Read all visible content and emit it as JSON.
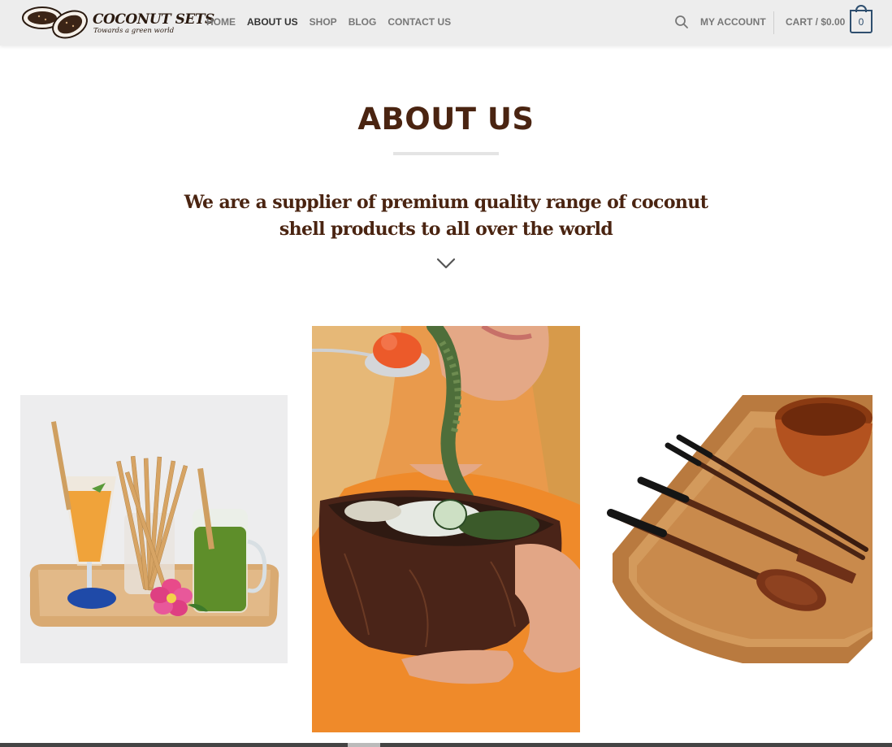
{
  "brand": {
    "name": "COCONUT SETS",
    "tagline": "Towards a green world"
  },
  "nav": {
    "items": [
      {
        "label": "HOME",
        "active": false
      },
      {
        "label": "ABOUT US",
        "active": true
      },
      {
        "label": "SHOP",
        "active": false
      },
      {
        "label": "BLOG",
        "active": false
      },
      {
        "label": "CONTACT US",
        "active": false
      }
    ],
    "account_label": "MY ACCOUNT",
    "cart_label": "CART / $0.00",
    "cart_count": "0"
  },
  "hero": {
    "title": "ABOUT US",
    "subtitle": "We are a supplier of premium quality range of coconut shell products to all over the world"
  },
  "gallery": {
    "images": [
      "bamboo-straws-photo",
      "coconut-bowl-photo",
      "wooden-utensils-photo"
    ]
  },
  "colors": {
    "brand_brown": "#4a2411",
    "cart_blue": "#2f4f6f",
    "header_bg": "#ededed"
  }
}
